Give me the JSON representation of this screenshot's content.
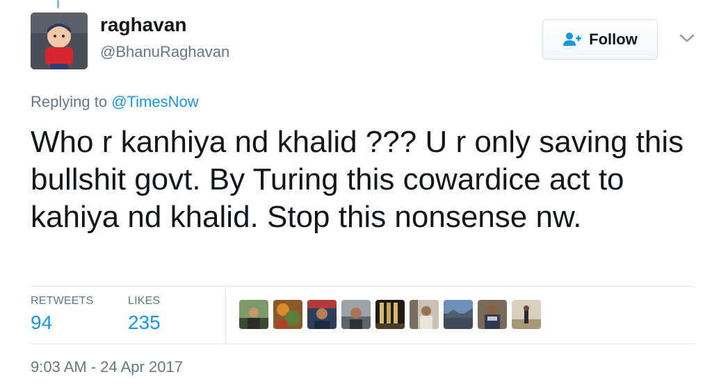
{
  "tweet": {
    "author": {
      "display_name": "raghavan",
      "screen_name": "@BhanuRaghavan"
    },
    "follow_button": {
      "label": "Follow",
      "icon": "add-user-icon"
    },
    "menu_icon": "chevron-down-icon",
    "replying_prefix": "Replying to",
    "replying_to": "@TimesNow",
    "text": "Who r kanhiya nd khalid ??? U r only saving this bullshit govt. By Turing this cowardice act to kahiya nd khalid. Stop this nonsense nw.",
    "stats": {
      "retweets_label": "RETWEETS",
      "retweets_count": "94",
      "likes_label": "LIKES",
      "likes_count": "235"
    },
    "timestamp": "9:03 AM - 24 Apr 2017"
  },
  "colors": {
    "link": "#1b95e0",
    "secondary_text": "#657786",
    "primary_text": "#14171a",
    "border": "#e1e8ed"
  }
}
